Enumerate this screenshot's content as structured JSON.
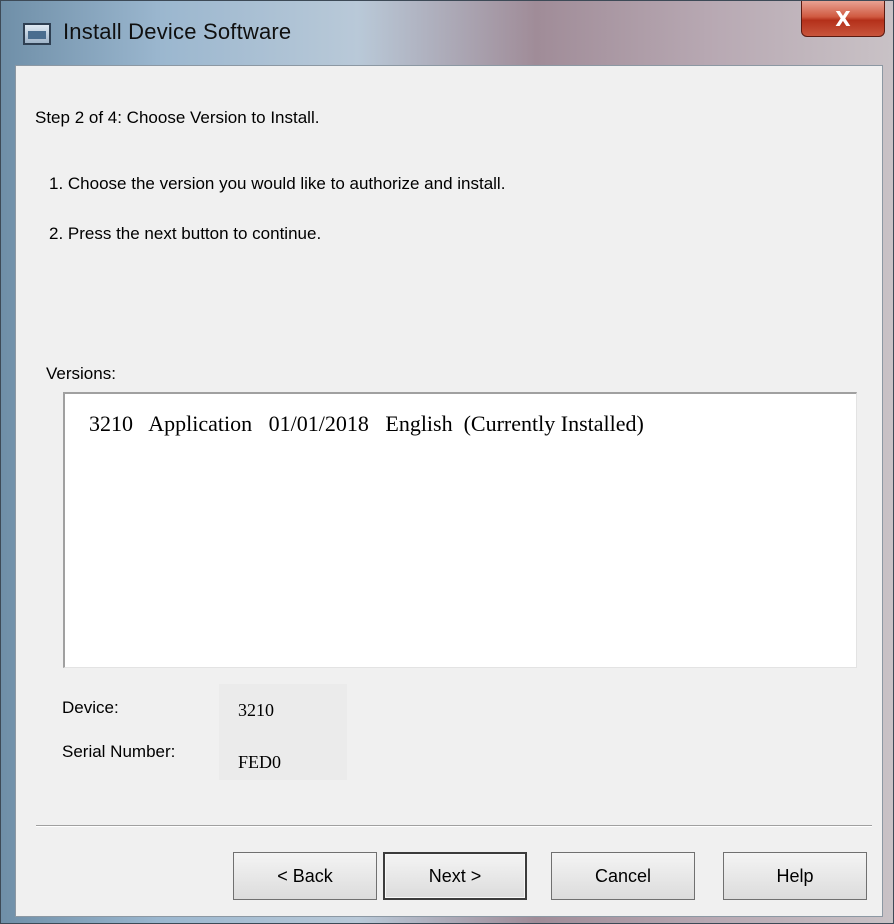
{
  "window": {
    "title": "Install Device Software",
    "close_symbol": "X",
    "icon": "window-app-icon"
  },
  "step": "Step 2 of 4:  Choose Version to Install.",
  "instructions": [
    "1.  Choose the version you would like to authorize and install.",
    "2.  Press the next button to continue."
  ],
  "versions": {
    "label": "Versions:",
    "items": [
      "3210   Application   01/01/2018   English  (Currently Installed)"
    ]
  },
  "device_info": {
    "device_label": "Device:",
    "device_value": "3210",
    "serial_label": "Serial Number:",
    "serial_value": "FED0"
  },
  "buttons": {
    "back": "< Back",
    "next": "Next >",
    "cancel": "Cancel",
    "help": "Help"
  }
}
